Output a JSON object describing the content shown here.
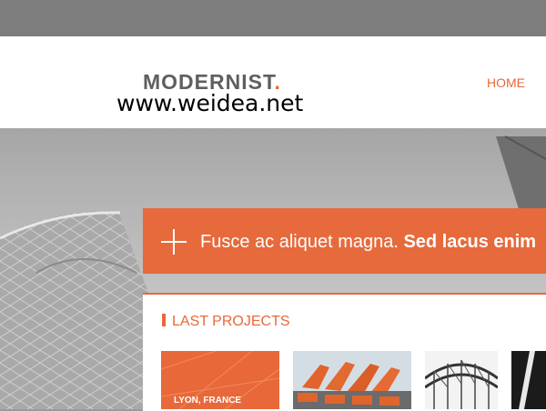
{
  "brand": {
    "name": "MODERNIST",
    "dot": "."
  },
  "watermark": "www.weidea.net",
  "nav": {
    "home": "HOME"
  },
  "banner": {
    "text_light": "Fusce ac aliquet magna. ",
    "text_bold": "Sed lacus enim"
  },
  "projects": {
    "title": "LAST PROJECTS",
    "tiles": [
      {
        "caption": "LYON, FRANCE"
      }
    ]
  },
  "colors": {
    "accent": "#e8683a",
    "banner": "#e66a3c",
    "logo": "#5f5f5f"
  }
}
